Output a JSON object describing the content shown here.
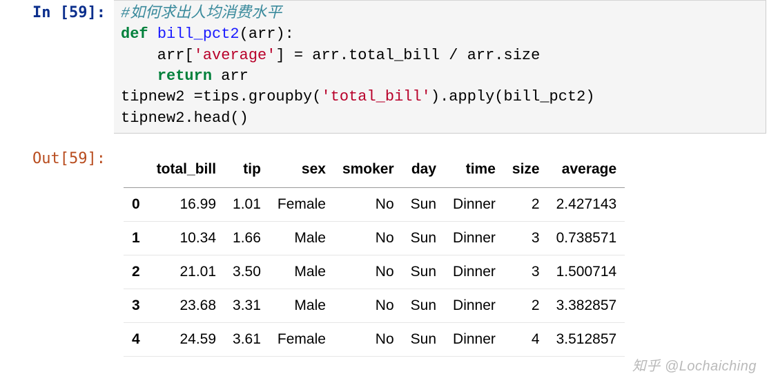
{
  "input": {
    "prompt": "In [59]:",
    "code_comment": "#如何求出人均消费水平",
    "kw_def": "def",
    "funcname": "bill_pct2",
    "arr_open": "(arr):",
    "line3_a": "    arr[",
    "line3_str": "'average'",
    "line3_b": "] = arr.total_bill / arr.size",
    "kw_return": "return",
    "line4_tail": " arr",
    "line5": "tipnew2 =tips.groupby(",
    "line5_str": "'total_bill'",
    "line5_tail": ").apply(bill_pct2)",
    "line6": "tipnew2.head()"
  },
  "output": {
    "prompt": "Out[59]:",
    "headers": [
      "",
      "total_bill",
      "tip",
      "sex",
      "smoker",
      "day",
      "time",
      "size",
      "average"
    ],
    "rows": [
      [
        "0",
        "16.99",
        "1.01",
        "Female",
        "No",
        "Sun",
        "Dinner",
        "2",
        "2.427143"
      ],
      [
        "1",
        "10.34",
        "1.66",
        "Male",
        "No",
        "Sun",
        "Dinner",
        "3",
        "0.738571"
      ],
      [
        "2",
        "21.01",
        "3.50",
        "Male",
        "No",
        "Sun",
        "Dinner",
        "3",
        "1.500714"
      ],
      [
        "3",
        "23.68",
        "3.31",
        "Male",
        "No",
        "Sun",
        "Dinner",
        "2",
        "3.382857"
      ],
      [
        "4",
        "24.59",
        "3.61",
        "Female",
        "No",
        "Sun",
        "Dinner",
        "4",
        "3.512857"
      ]
    ]
  },
  "watermark": "知乎 @Lochaiching"
}
